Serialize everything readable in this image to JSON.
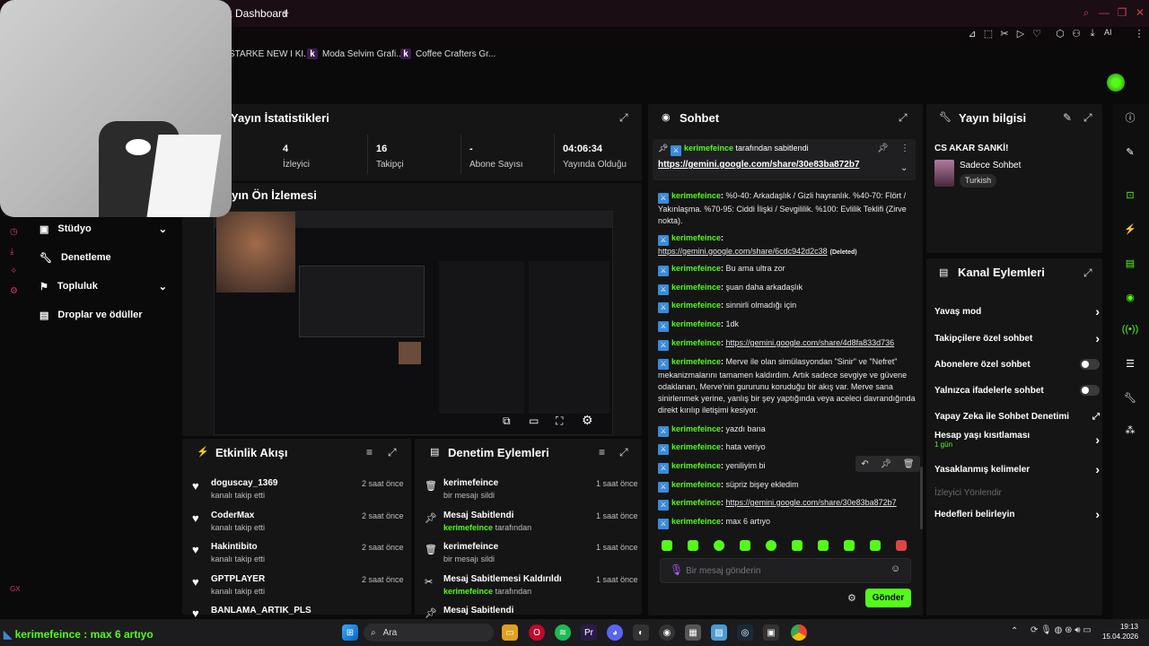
{
  "browser": {
    "tab_title": "Kick Dashboard",
    "new_tab": "+",
    "bookmarks": [
      {
        "label": "STARKE NEW I KI...",
        "icon": ""
      },
      {
        "label": "Moda Selvim Grafi...",
        "icon": "k"
      },
      {
        "label": "Coffee Crafters Gr...",
        "icon": "k"
      }
    ],
    "ai_label": "AI"
  },
  "stats": {
    "title": "Yayın İstatistikleri",
    "items": [
      {
        "value": "4",
        "label": "İzleyici"
      },
      {
        "value": "16",
        "label": "Takipçi"
      },
      {
        "value": "-",
        "label": "Abone Sayısı"
      },
      {
        "value": "04:06:34",
        "label": "Yayında Olduğu"
      }
    ]
  },
  "preview": {
    "title": "Yayın Ön İzlemesi"
  },
  "nav": {
    "items": [
      {
        "label": "Stüdyo",
        "icon": "studio-icon",
        "chevron": true
      },
      {
        "label": "Denetleme",
        "icon": "wrench-icon",
        "chevron": false
      },
      {
        "label": "Topluluk",
        "icon": "community-icon",
        "chevron": true
      },
      {
        "label": "Droplar ve ödüller",
        "icon": "gift-icon",
        "chevron": false
      }
    ]
  },
  "activity": {
    "title": "Etkinlik Akışı",
    "items": [
      {
        "name": "doguscay_1369",
        "sub": "kanalı takip etti",
        "time": "2 saat önce"
      },
      {
        "name": "CoderMax",
        "sub": "kanalı takip etti",
        "time": "2 saat önce"
      },
      {
        "name": "Hakintibito",
        "sub": "kanalı takip etti",
        "time": "2 saat önce"
      },
      {
        "name": "GPTPLAYER",
        "sub": "kanalı takip etti",
        "time": "2 saat önce"
      },
      {
        "name": "BANLAMA_ARTIK_PLS",
        "sub": "",
        "time": ""
      }
    ]
  },
  "moderation": {
    "title": "Denetim Eylemleri",
    "items": [
      {
        "name": "kerimefeince",
        "sub": "bir mesajı sildi",
        "sub_user": "",
        "time": "1 saat önce",
        "icon": "trash-icon"
      },
      {
        "name": "Mesaj Sabitlendi",
        "sub": "tarafından",
        "sub_user": "kerimefeince",
        "time": "1 saat önce",
        "icon": "pin-icon"
      },
      {
        "name": "kerimefeince",
        "sub": "bir mesajı sildi",
        "sub_user": "",
        "time": "1 saat önce",
        "icon": "trash-icon"
      },
      {
        "name": "Mesaj Sabitlemesi Kaldırıldı",
        "sub": "tarafından",
        "sub_user": "kerimefeince",
        "time": "1 saat önce",
        "icon": "unpin-icon"
      },
      {
        "name": "Mesaj Sabitlendi",
        "sub": "",
        "sub_user": "",
        "time": "",
        "icon": "pin-icon"
      }
    ]
  },
  "chat": {
    "title": "Sohbet",
    "pinned_by": "tarafından sabitlendi",
    "pinned_user": "kerimefeince",
    "pinned_link": "https://gemini.google.com/share/30e83ba872b7",
    "messages": [
      {
        "user": "kerimefeince",
        "text": "%0-40: Arkadaşlık / Gizli hayranlık. %40-70: Flört / Yakınlaşma. %70-95: Ciddi İlişki / Sevgililik. %100: Evlilik Teklifi (Zirve nokta).",
        "link": "",
        "deleted": ""
      },
      {
        "user": "kerimefeince",
        "text": "",
        "link": "https://gemini.google.com/share/6cdc942d2c38",
        "deleted": "(Deleted)"
      },
      {
        "user": "kerimefeince",
        "text": "Bu ama ultra zor",
        "link": "",
        "deleted": ""
      },
      {
        "user": "kerimefeince",
        "text": "şuan daha arkadaşlık",
        "link": "",
        "deleted": ""
      },
      {
        "user": "kerimefeince",
        "text": "sinnirli olmadığı için",
        "link": "",
        "deleted": ""
      },
      {
        "user": "kerimefeince",
        "text": "1dk",
        "link": "",
        "deleted": ""
      },
      {
        "user": "kerimefeince",
        "text": "",
        "link": "https://gemini.google.com/share/4d8fa833d736",
        "deleted": ""
      },
      {
        "user": "kerimefeince",
        "text": "Merve ile olan simülasyondan \"Sinir\" ve \"Nefret\" mekanizmalarını tamamen kaldırdım. Artık sadece sevgiye ve güvene odaklanan, Merve'nin gururunu koruduğu bir akış var. Merve sana sinirlenmek yerine, yanlış bir şey yaptığında veya aceleci davrandığında direkt kırılıp iletişimi kesiyor.",
        "link": "",
        "deleted": ""
      },
      {
        "user": "kerimefeince",
        "text": "yazdı bana",
        "link": "",
        "deleted": ""
      },
      {
        "user": "kerimefeince",
        "text": "hata veriyo",
        "link": "",
        "deleted": ""
      },
      {
        "user": "kerimefeince",
        "text": "yeniliyim bi",
        "link": "",
        "deleted": ""
      },
      {
        "user": "kerimefeince",
        "text": "süpriz bişey ekledim",
        "link": "",
        "deleted": ""
      },
      {
        "user": "kerimefeince",
        "text": "",
        "link": "https://gemini.google.com/share/30e83ba872b7",
        "deleted": ""
      },
      {
        "user": "kerimefeince",
        "text": "max 6 artıyo",
        "link": "",
        "deleted": ""
      }
    ],
    "input_placeholder": "Bir mesaj gönderin",
    "send_label": "Gönder"
  },
  "stream_info": {
    "title": "Yayın bilgisi",
    "stream_title": "CS AKAR SANKİ!",
    "category": "Sadece Sohbet",
    "language": "Turkish"
  },
  "channel_actions": {
    "title": "Kanal Eylemleri",
    "items": [
      {
        "label": "Yavaş mod",
        "type": "chevron",
        "sub": ""
      },
      {
        "label": "Takipçilere özel sohbet",
        "type": "chevron",
        "sub": ""
      },
      {
        "label": "Abonelere özel sohbet",
        "type": "toggle",
        "sub": ""
      },
      {
        "label": "Yalnızca ifadelerle sohbet",
        "type": "toggle",
        "sub": ""
      },
      {
        "label": "Yapay Zeka ile Sohbet Denetimi",
        "type": "external",
        "sub": ""
      },
      {
        "label": "Hesap yaşı kısıtlaması",
        "type": "chevron",
        "sub": "1 gün"
      },
      {
        "label": "Yasaklanmış kelimeler",
        "type": "chevron",
        "sub": ""
      },
      {
        "label": "İzleyici Yönlendir",
        "type": "disabled",
        "sub": ""
      },
      {
        "label": "Hedefleri belirleyin",
        "type": "chevron",
        "sub": ""
      }
    ]
  },
  "overlay": {
    "text": "kerimefeince : max 6 artıyo"
  },
  "taskbar": {
    "search_label": "Ara",
    "time": "19:13",
    "date": "15.04.2026"
  },
  "colors": {
    "accent": "#53fc18",
    "panel": "#151516",
    "bg": "#0a0a0b"
  }
}
